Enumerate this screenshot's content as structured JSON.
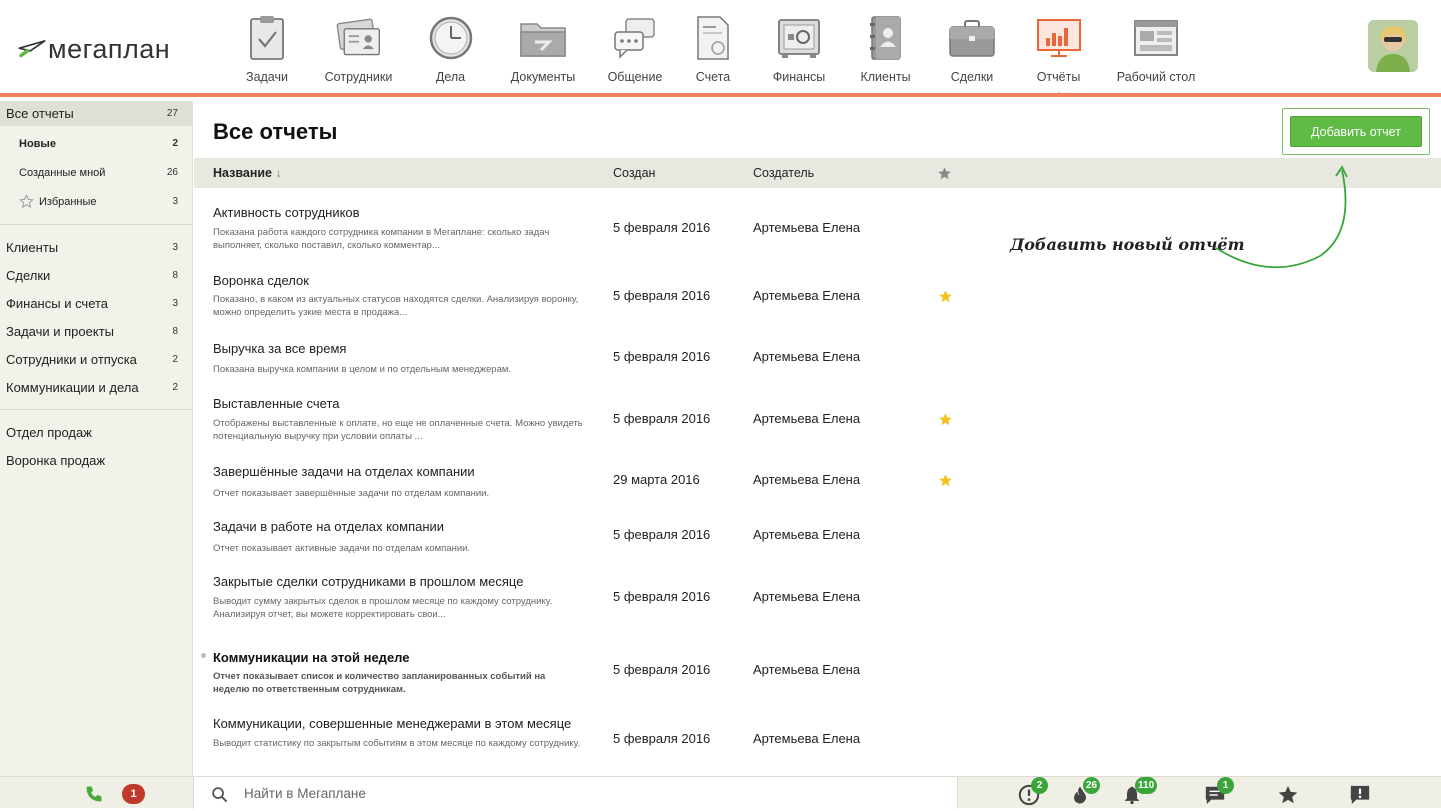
{
  "app": {
    "logo_text": "мегаплан"
  },
  "nav": [
    {
      "id": "tasks",
      "label": "Задачи",
      "icon": "tasks-clipboard-icon"
    },
    {
      "id": "employees",
      "label": "Сотрудники",
      "icon": "employees-cards-icon"
    },
    {
      "id": "deals",
      "label": "Дела",
      "icon": "clock-icon"
    },
    {
      "id": "documents",
      "label": "Документы",
      "icon": "folder-icon"
    },
    {
      "id": "chat",
      "label": "Общение",
      "icon": "chat-bubbles-icon"
    },
    {
      "id": "invoices",
      "label": "Счета",
      "icon": "invoice-icon"
    },
    {
      "id": "finance",
      "label": "Финансы",
      "icon": "safe-icon"
    },
    {
      "id": "clients",
      "label": "Клиенты",
      "icon": "contact-book-icon"
    },
    {
      "id": "sales",
      "label": "Сделки",
      "icon": "briefcase-icon"
    },
    {
      "id": "reports",
      "label": "Отчёты",
      "icon": "reports-chart-icon",
      "active": true
    },
    {
      "id": "desktop",
      "label": "Рабочий стол",
      "icon": "dashboard-icon"
    }
  ],
  "sidebar": {
    "all": {
      "label": "Все отчеты",
      "count": "27"
    },
    "sub": [
      {
        "label": "Новые",
        "count": "2",
        "bold": true
      },
      {
        "label": "Созданные мной",
        "count": "26"
      },
      {
        "label": "Избранные",
        "count": "3",
        "icon": "star-outline-icon"
      }
    ],
    "categories": [
      {
        "label": "Клиенты",
        "count": "3"
      },
      {
        "label": "Сделки",
        "count": "8"
      },
      {
        "label": "Финансы и счета",
        "count": "3"
      },
      {
        "label": "Задачи и проекты",
        "count": "8"
      },
      {
        "label": "Сотрудники и отпуска",
        "count": "2"
      },
      {
        "label": "Коммуникации и дела",
        "count": "2"
      }
    ],
    "custom": [
      {
        "label": "Отдел продаж"
      },
      {
        "label": "Воронка продаж"
      }
    ]
  },
  "main": {
    "title": "Все отчеты",
    "add_button": "Добавить отчет",
    "columns": {
      "name": "Название",
      "sort_arrow": "↓",
      "created": "Создан",
      "creator": "Создатель"
    },
    "annotation": "Добавить новый отчёт"
  },
  "reports": [
    {
      "title": "Активность сотрудников",
      "desc": "Показана работа каждого сотрудника компании в Мегаплане: сколько задач выполняет, сколько поставил, сколько комментар...",
      "date": "5 февраля 2016",
      "author": "Артемьева Елена",
      "fav": false
    },
    {
      "title": "Воронка сделок",
      "desc": "Показано, в каком из актуальных статусов находятся сделки. Анализируя воронку, можно определить узкие места в продажа...",
      "date": "5 февраля 2016",
      "author": "Артемьева Елена",
      "fav": true
    },
    {
      "title": "Выручка за все время",
      "desc": "Показана выручка компании в целом и по отдельным менеджерам.",
      "date": "5 февраля 2016",
      "author": "Артемьева Елена",
      "fav": false
    },
    {
      "title": "Выставленные счета",
      "desc": "Отображены выставленные к оплате, но еще не оплаченные счета. Можно увидеть потенциальную выручку при условии оплаты ...",
      "date": "5 февраля 2016",
      "author": "Артемьева Елена",
      "fav": true
    },
    {
      "title": "Завершённые задачи на отделах компании",
      "desc": "Отчет показывает завершённые задачи по отделам компании.",
      "date": "29 марта 2016",
      "author": "Артемьева Елена",
      "fav": true
    },
    {
      "title": "Задачи в работе на отделах компании",
      "desc": "Отчет показывает активные задачи по отделам компании.",
      "date": "5 февраля 2016",
      "author": "Артемьева Елена",
      "fav": false
    },
    {
      "title": "Закрытые сделки сотрудниками в прошлом месяце",
      "desc": "Выводит сумму закрытых сделок в прошлом месяце по каждому сотруднику. Анализируя отчет, вы можете корректировать свои...",
      "date": "5 февраля 2016",
      "author": "Артемьева Елена",
      "fav": false
    },
    {
      "title": "Коммуникации на этой неделе",
      "desc": "Отчет показывает список и количество запланированных событий на неделю по ответственным сотрудникам.",
      "date": "5 февраля 2016",
      "author": "Артемьева Елена",
      "fav": false,
      "unread": true
    },
    {
      "title": "Коммуникации, совершенные менеджерами в этом месяце",
      "desc": "Выводит статистику по закрытым событиям в этом месяце по каждому сотруднику.",
      "date": "5 февраля 2016",
      "author": "Артемьева Елена",
      "fav": false
    }
  ],
  "bottombar": {
    "phone_badge": "1",
    "search_placeholder": "Найти в Мегаплане",
    "alerts_badge": "2",
    "hot_badge": "26",
    "notifications_badge": "110",
    "messages_badge": "1"
  },
  "colors": {
    "accent": "#f0815a",
    "green": "#5fbb45",
    "star": "#f2c31b"
  }
}
